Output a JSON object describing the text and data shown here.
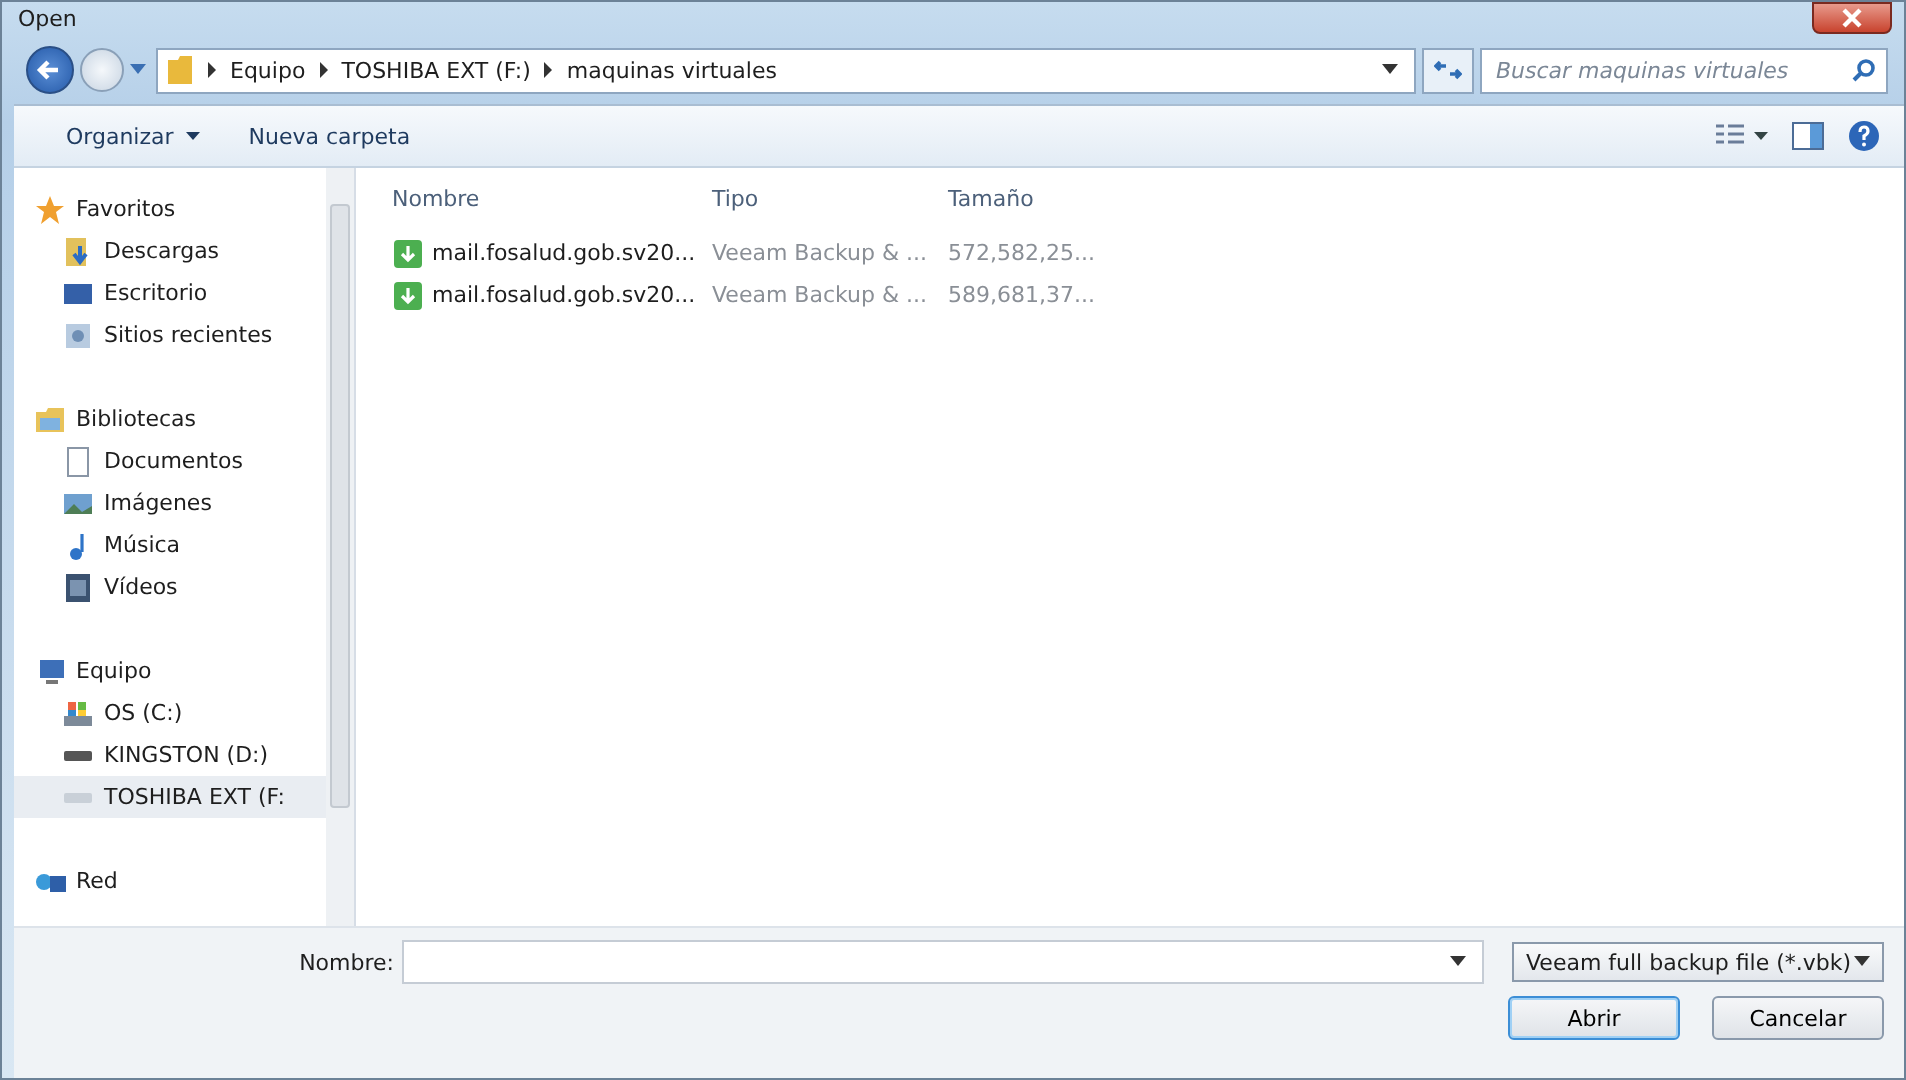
{
  "window": {
    "title": "Open"
  },
  "address": {
    "crumbs": [
      "Equipo",
      "TOSHIBA EXT (F:)",
      "maquinas virtuales"
    ]
  },
  "search": {
    "placeholder": "Buscar maquinas virtuales"
  },
  "toolbar": {
    "organize": "Organizar",
    "new_folder": "Nueva carpeta"
  },
  "sidebar": {
    "groups": [
      {
        "label": "Favoritos",
        "kind": "star",
        "children": [
          {
            "label": "Descargas",
            "kind": "download",
            "selected": false
          },
          {
            "label": "Escritorio",
            "kind": "desktop",
            "selected": false
          },
          {
            "label": "Sitios recientes",
            "kind": "recent",
            "selected": false
          }
        ]
      },
      {
        "label": "Bibliotecas",
        "kind": "library",
        "children": [
          {
            "label": "Documentos",
            "kind": "document",
            "selected": false
          },
          {
            "label": "Imágenes",
            "kind": "image",
            "selected": false
          },
          {
            "label": "Música",
            "kind": "music",
            "selected": false
          },
          {
            "label": "Vídeos",
            "kind": "video",
            "selected": false
          }
        ]
      },
      {
        "label": "Equipo",
        "kind": "computer",
        "children": [
          {
            "label": "OS (C:)",
            "kind": "osdrive",
            "selected": false
          },
          {
            "label": "KINGSTON (D:)",
            "kind": "drive",
            "selected": false
          },
          {
            "label": "TOSHIBA EXT (F:",
            "kind": "drive",
            "selected": true
          }
        ]
      },
      {
        "label": "Red",
        "kind": "network"
      }
    ]
  },
  "table": {
    "columns": [
      "Nombre",
      "Tipo",
      "Tamaño"
    ],
    "rows": [
      {
        "name": "mail.fosalud.gob.sv20...",
        "type": "Veeam Backup & ...",
        "size": "572,582,25..."
      },
      {
        "name": "mail.fosalud.gob.sv20...",
        "type": "Veeam Backup & ...",
        "size": "589,681,37..."
      }
    ]
  },
  "footer": {
    "name_label": "Nombre:",
    "file_type": "Veeam full backup file (*.vbk)",
    "buttons": [
      {
        "label": "Abrir",
        "default": true
      },
      {
        "label": "Cancelar",
        "default": false
      }
    ]
  }
}
